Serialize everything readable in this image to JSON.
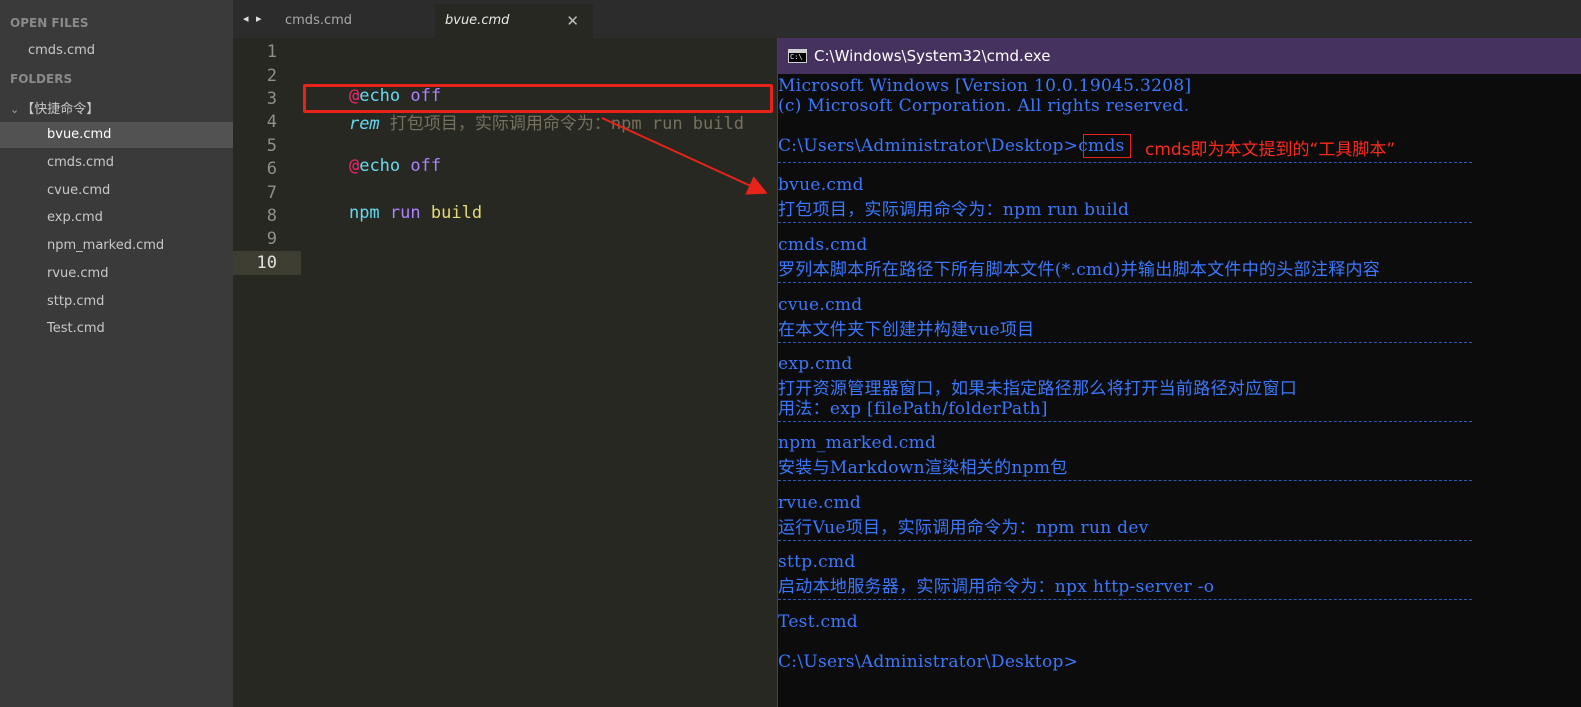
{
  "sidebar": {
    "open_files_label": "OPEN FILES",
    "open_files": [
      "cmds.cmd"
    ],
    "folders_label": "FOLDERS",
    "folder_name": "【快捷命令】",
    "folder_icon": "chevron-down-icon",
    "files": [
      "bvue.cmd",
      "cmds.cmd",
      "cvue.cmd",
      "exp.cmd",
      "npm_marked.cmd",
      "rvue.cmd",
      "sttp.cmd",
      "Test.cmd"
    ],
    "selected_file": "bvue.cmd"
  },
  "tabs": {
    "nav_arrows": "◂ ▸",
    "items": [
      {
        "label": "cmds.cmd",
        "active": false
      },
      {
        "label": "bvue.cmd",
        "active": true,
        "close": "✕"
      }
    ]
  },
  "editor": {
    "line_numbers": [
      "1",
      "2",
      "3",
      "4",
      "5",
      "6",
      "7",
      "8",
      "9",
      "10"
    ],
    "current_line": "10",
    "line2": {
      "at": "@",
      "cmd": "echo",
      "arg": "off"
    },
    "line3": {
      "rem": "rem",
      "comment": "打包项目，实际调用命令为：npm run build"
    },
    "line5": {
      "at": "@",
      "cmd": "echo",
      "arg": "off"
    },
    "line7": {
      "cmd": "npm",
      "arg1": "run",
      "arg2": "build"
    }
  },
  "console": {
    "title": "C:\\Windows\\System32\\cmd.exe",
    "header1": "Microsoft Windows [Version 10.0.19045.3208]",
    "header2": "(c) Microsoft Corporation. All rights reserved.",
    "prompt": "C:\\Users\\Administrator\\Desktop>",
    "typed_command": "cmds",
    "annotation": "cmds即为本文提到的“工具脚本”",
    "entries": [
      {
        "name": "bvue.cmd",
        "lines": [
          "打包项目，实际调用命令为：npm run build"
        ]
      },
      {
        "name": "cmds.cmd",
        "lines": [
          "罗列本脚本所在路径下所有脚本文件(*.cmd)并输出脚本文件中的头部注释内容"
        ]
      },
      {
        "name": "cvue.cmd",
        "lines": [
          "在本文件夹下创建并构建vue项目"
        ]
      },
      {
        "name": "exp.cmd",
        "lines": [
          "打开资源管理器窗口，如果未指定路径那么将打开当前路径对应窗口",
          "用法：exp [filePath/folderPath]"
        ]
      },
      {
        "name": "npm_marked.cmd",
        "lines": [
          "安装与Markdown渲染相关的npm包"
        ]
      },
      {
        "name": "rvue.cmd",
        "lines": [
          "运行Vue项目，实际调用命令为：npm run dev"
        ]
      },
      {
        "name": "sttp.cmd",
        "lines": [
          "启动本地服务器，实际调用命令为：npx http-server -o"
        ]
      },
      {
        "name": "Test.cmd",
        "lines": []
      }
    ],
    "final_prompt": "C:\\Users\\Administrator\\Desktop>"
  },
  "colors": {
    "annotation_red": "#e8231a",
    "console_blue": "#3b78ff",
    "titlebar": "#45325f"
  }
}
